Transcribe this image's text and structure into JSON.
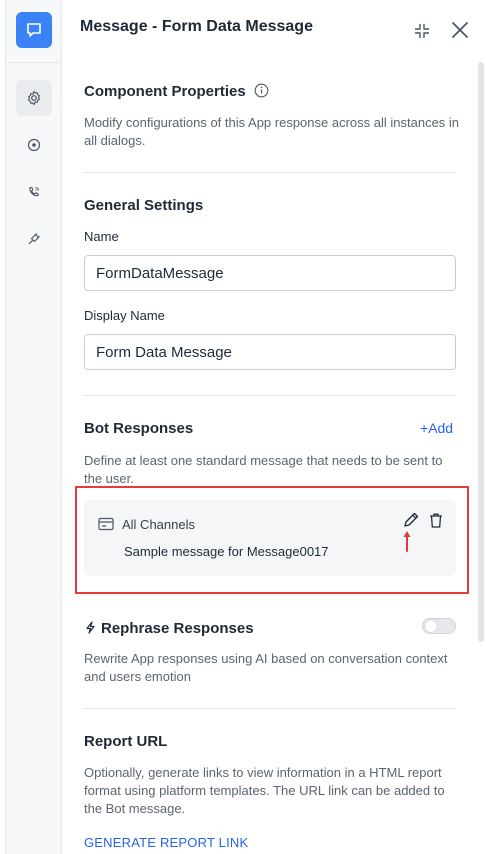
{
  "header": {
    "title": "Message - Form Data Message"
  },
  "rail": {
    "items": [
      "message-icon",
      "gear-icon",
      "target-icon",
      "phone-voice-icon",
      "plug-icon"
    ]
  },
  "component_properties": {
    "title": "Component Properties",
    "description": "Modify configurations of this App response across all instances in all dialogs."
  },
  "general_settings": {
    "title": "General Settings",
    "name_label": "Name",
    "name_value": "FormDataMessage",
    "display_name_label": "Display Name",
    "display_name_value": "Form Data Message"
  },
  "bot_responses": {
    "title": "Bot Responses",
    "add_label": "Add",
    "description": "Define at least one standard message that needs to be sent to the user.",
    "card": {
      "channel": "All Channels",
      "message": "Sample message for Message0017"
    }
  },
  "rephrase": {
    "title": "Rephrase Responses",
    "description": "Rewrite App responses using AI based on conversation context and users emotion",
    "enabled": false
  },
  "report_url": {
    "title": "Report URL",
    "description": "Optionally, generate links to view information in a HTML report format using platform templates. The URL link can be added to the Bot message.",
    "link_label": "GENERATE REPORT LINK"
  },
  "colors": {
    "accent": "#3b82f6",
    "link": "#2563eb",
    "highlight": "#e23b3b"
  }
}
